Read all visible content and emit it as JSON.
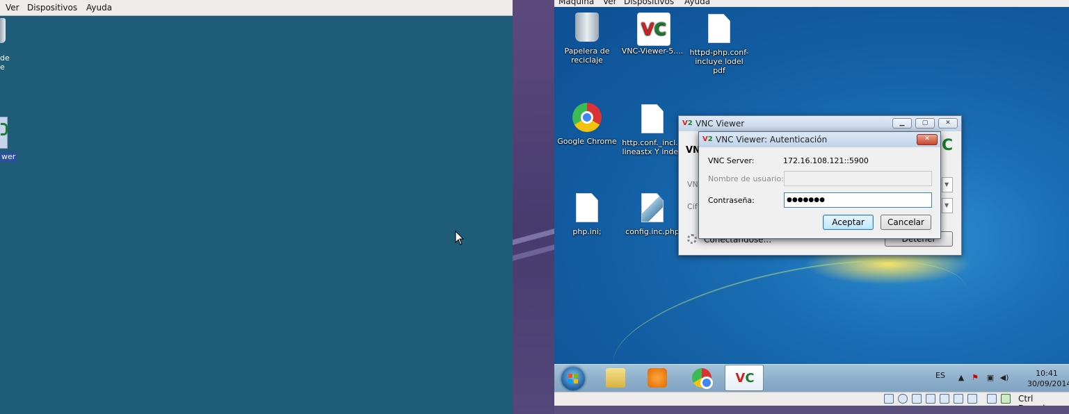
{
  "left_vm": {
    "menu": [
      "Ver",
      "Dispositivos",
      "Ayuda"
    ],
    "partial_icon_label": "de\ne",
    "partial_selected_label": "wer"
  },
  "right_vm": {
    "menu": [
      "Máquina",
      "Ver",
      "Dispositivos",
      "Ayuda"
    ],
    "desktop_icons": [
      {
        "label": "Papelera de reciclaje",
        "icon": "recycle-bin-icon"
      },
      {
        "label": "VNC-Viewer-5....",
        "icon": "vnc-icon"
      },
      {
        "label": "httpd-php.conf- incluye lodel pdf",
        "icon": "document-icon"
      },
      {
        "label": "Google Chrome",
        "icon": "chrome-icon"
      },
      {
        "label": "http.conf._incl... lineastx Y index",
        "icon": "document-icon"
      },
      {
        "label": "php.ini;",
        "icon": "document-icon"
      },
      {
        "label": "config.inc.php",
        "icon": "script-icon"
      }
    ],
    "taskbar": {
      "lang": "ES",
      "time": "10:41",
      "date": "30/09/2014",
      "items": [
        "explorer-icon",
        "media-player-icon",
        "chrome-icon",
        "vnc-icon"
      ]
    },
    "status_bar": {
      "host_key": "Ctrl Derecho"
    }
  },
  "vnc_main": {
    "title": "VNC Viewer",
    "header_partial": "VN",
    "label1_partial": "VN",
    "label2_partial": "Cif",
    "status": "Conectándose...",
    "stop_label": "Detener"
  },
  "auth_dialog": {
    "title": "VNC Viewer: Autenticación",
    "server_label": "VNC Server:",
    "server_value": "172.16.108.121::5900",
    "username_label": "Nombre de usuario:",
    "username_value": "",
    "password_label": "Contraseña:",
    "password_value": "●●●●●●●",
    "ok_label": "Aceptar",
    "cancel_label": "Cancelar"
  },
  "colors": {
    "left_desktop": "#1f5c77",
    "win7_blue": "#135ea3",
    "taskbar": "#8fb0cb"
  }
}
